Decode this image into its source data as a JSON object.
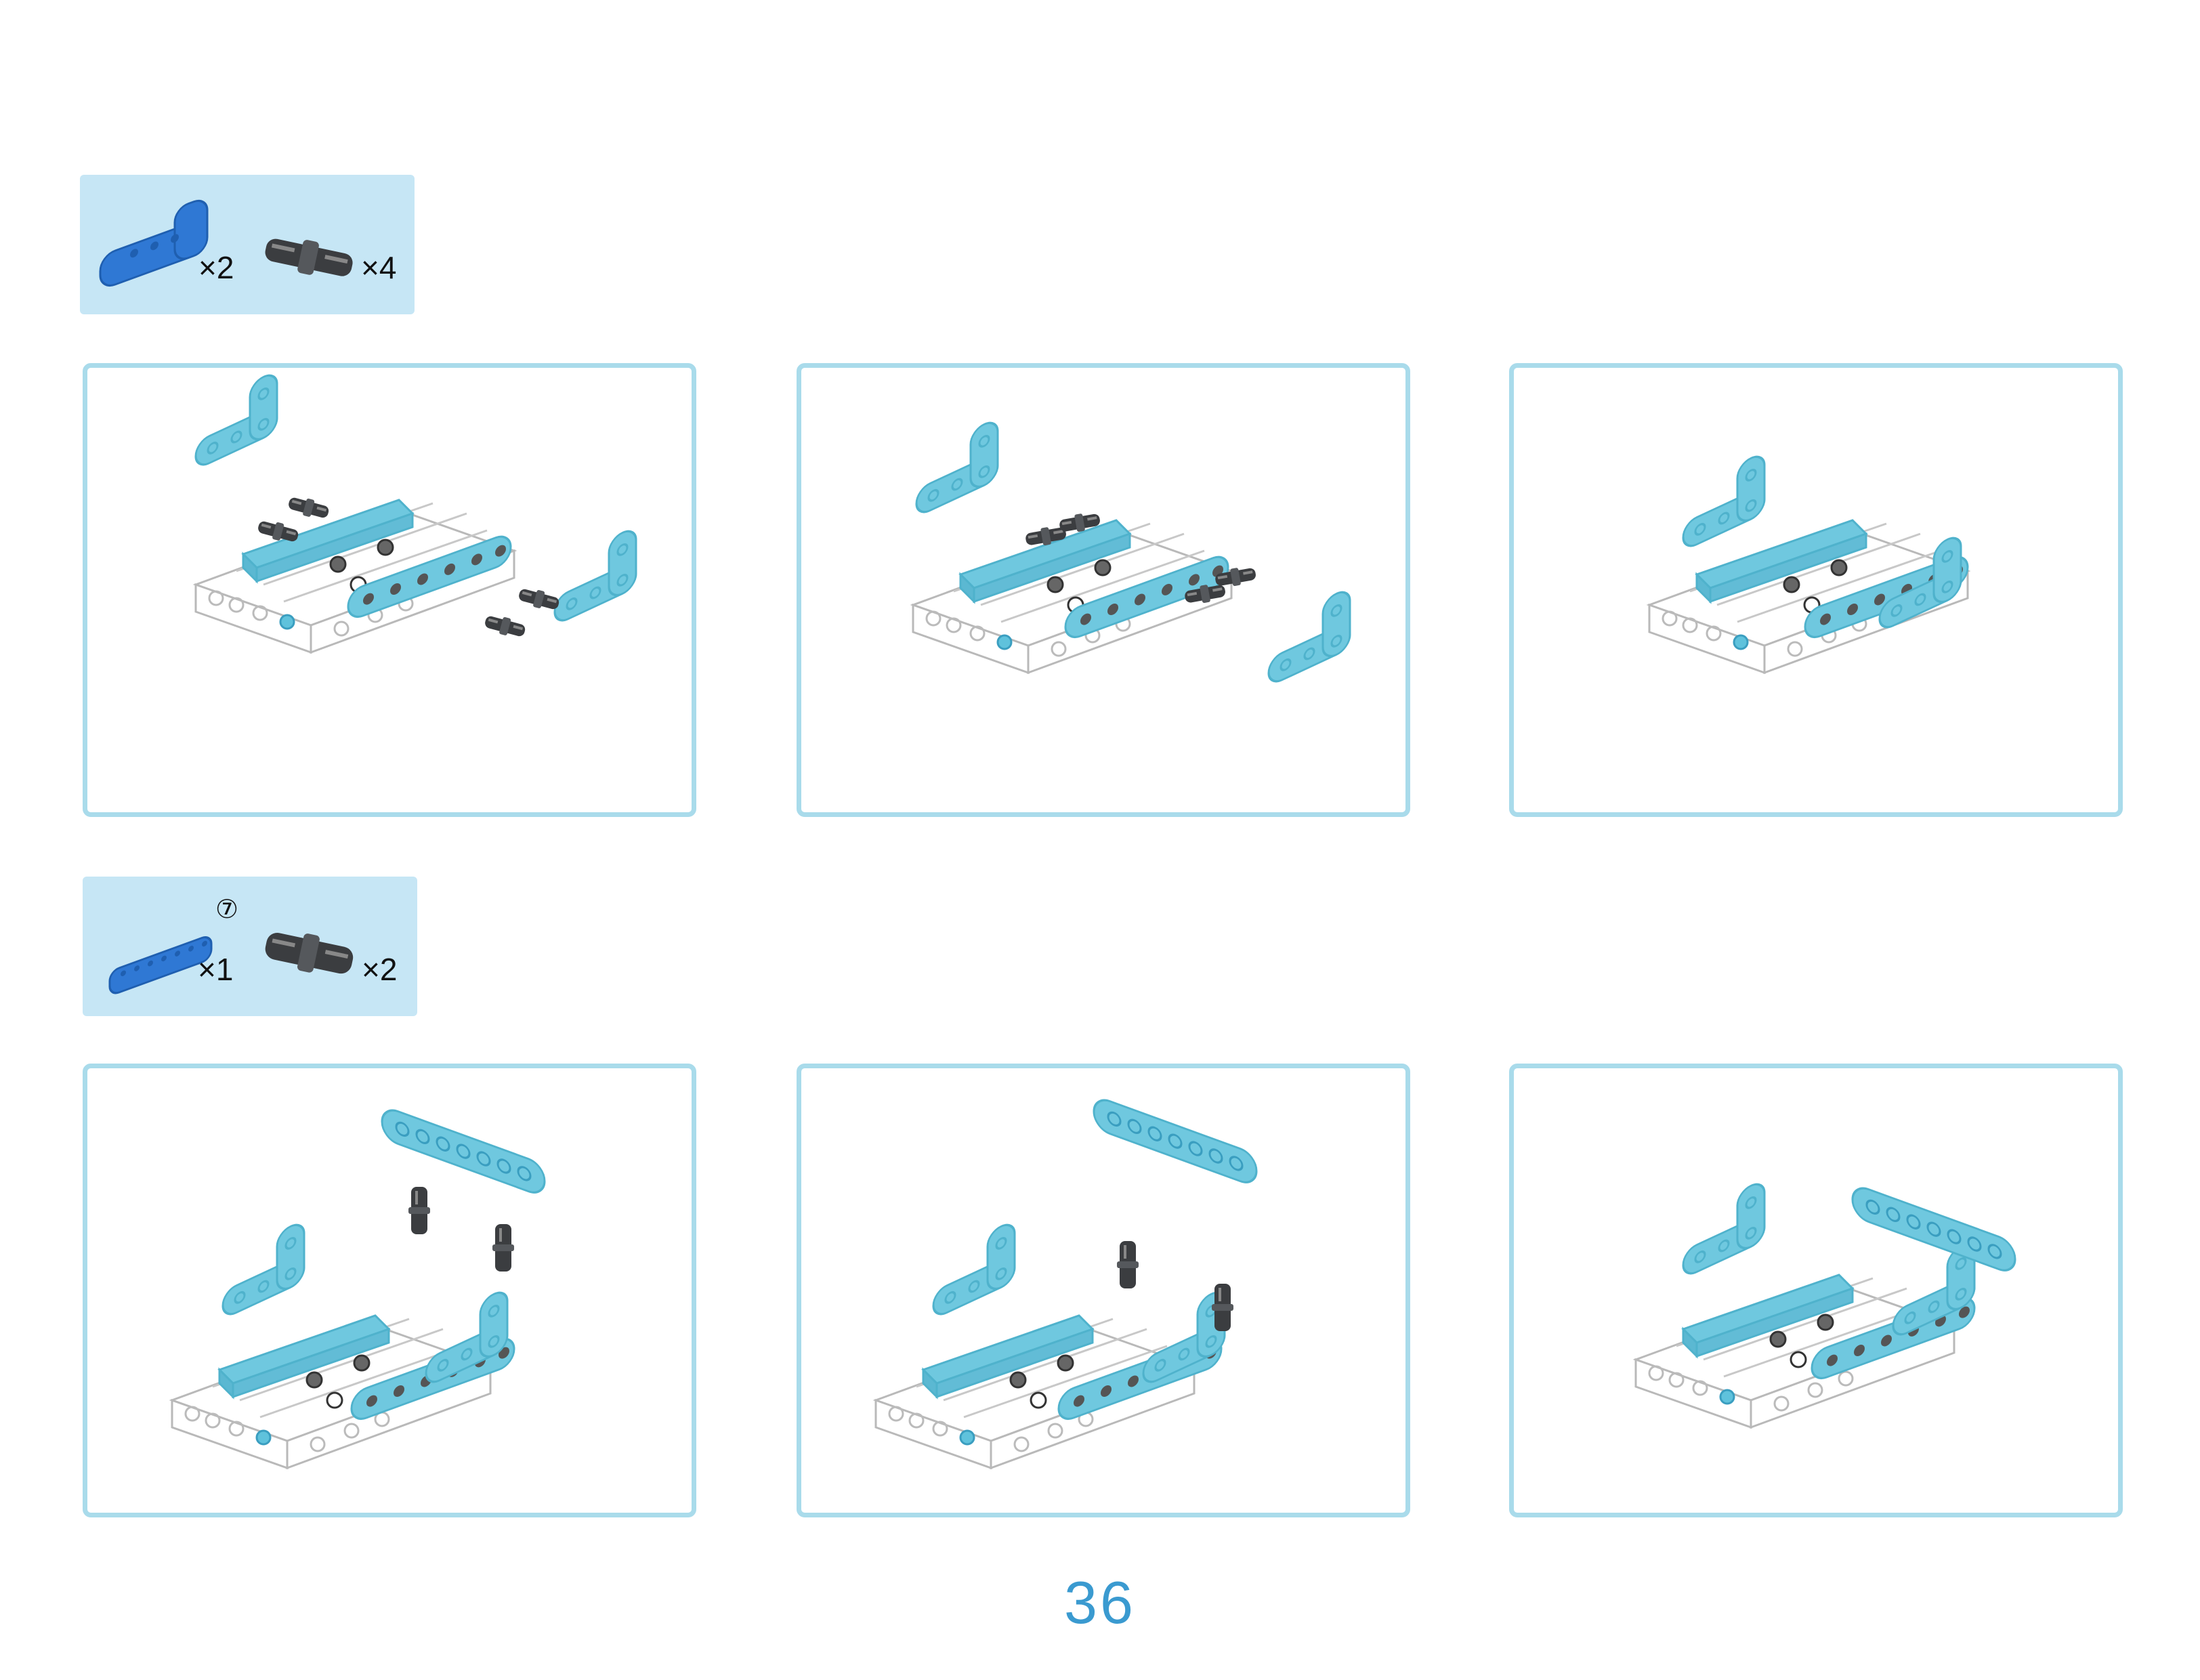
{
  "page_number": "36",
  "colors": {
    "parts_box_bg": "#c6e6f5",
    "panel_border": "#a9dbeb",
    "beam_blue": "#2f78d4",
    "model_beam_cyan": "#6fc8df",
    "pin_dark": "#3b3d40",
    "page_number": "#3a9ad0"
  },
  "parts_lists": [
    {
      "items": [
        {
          "icon": "l-beam-icon",
          "quantity": "×2"
        },
        {
          "icon": "connector-pin-icon",
          "quantity": "×4"
        }
      ]
    },
    {
      "items": [
        {
          "icon": "straight-beam-icon",
          "size_label": "⑦",
          "quantity": "×1"
        },
        {
          "icon": "connector-pin-icon",
          "quantity": "×2"
        }
      ]
    }
  ],
  "steps": [
    {
      "id": "1",
      "description_icon": "exploded-l-beams-and-pins"
    },
    {
      "id": "2",
      "description_icon": "pins-inserted"
    },
    {
      "id": "3",
      "description_icon": "l-beams-attached"
    },
    {
      "id": "4",
      "description_icon": "exploded-beam-and-pins"
    },
    {
      "id": "5",
      "description_icon": "pins-inserted-top"
    },
    {
      "id": "6",
      "description_icon": "beam-attached-top"
    }
  ]
}
